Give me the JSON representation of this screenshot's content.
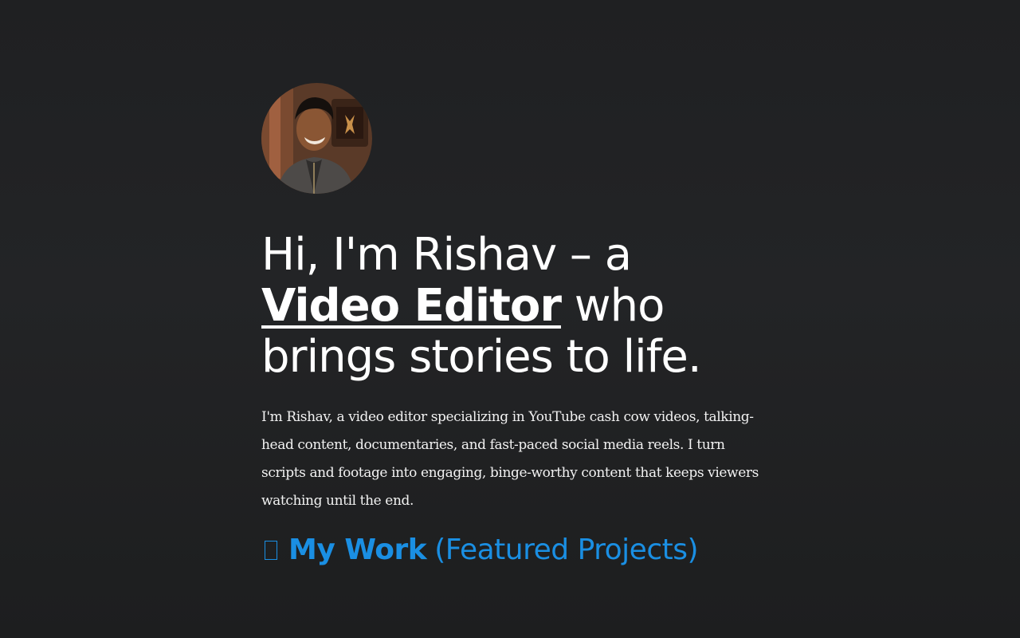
{
  "hero": {
    "avatar_alt": "Rishav portrait",
    "headline_line1": "Hi, I'm Rishav – a",
    "headline_role": "Video Editor",
    "headline_rest_1": " who",
    "headline_line3": "brings stories to life.",
    "bio": "I'm Rishav, a video editor specializing in YouTube cash cow videos, talking-head content, documentaries, and fast-paced social media reels. I turn scripts and footage into engaging, binge-worthy content that keeps viewers watching until the end."
  },
  "work": {
    "icon": "missing-glyph-icon",
    "title_strong": "My Work",
    "title_light": "(Featured Projects)"
  },
  "colors": {
    "background": "#1f2022",
    "accent": "#1a8fe3",
    "text": "#ffffff"
  }
}
